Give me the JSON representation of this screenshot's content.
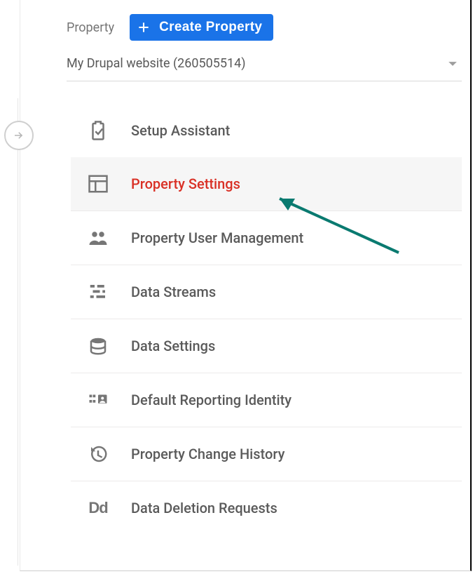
{
  "header": {
    "column_label": "Property",
    "create_button": "Create Property"
  },
  "selector": {
    "text": "My Drupal website (260505514)"
  },
  "menu": {
    "items": [
      {
        "label": "Setup Assistant"
      },
      {
        "label": "Property Settings"
      },
      {
        "label": "Property User Management"
      },
      {
        "label": "Data Streams"
      },
      {
        "label": "Data Settings"
      },
      {
        "label": "Default Reporting Identity"
      },
      {
        "label": "Property Change History"
      },
      {
        "label": "Data Deletion Requests"
      }
    ],
    "selected_index": 1
  },
  "colors": {
    "primary": "#1a73e8",
    "danger": "#d93025",
    "annotation": "#0a7a70"
  }
}
